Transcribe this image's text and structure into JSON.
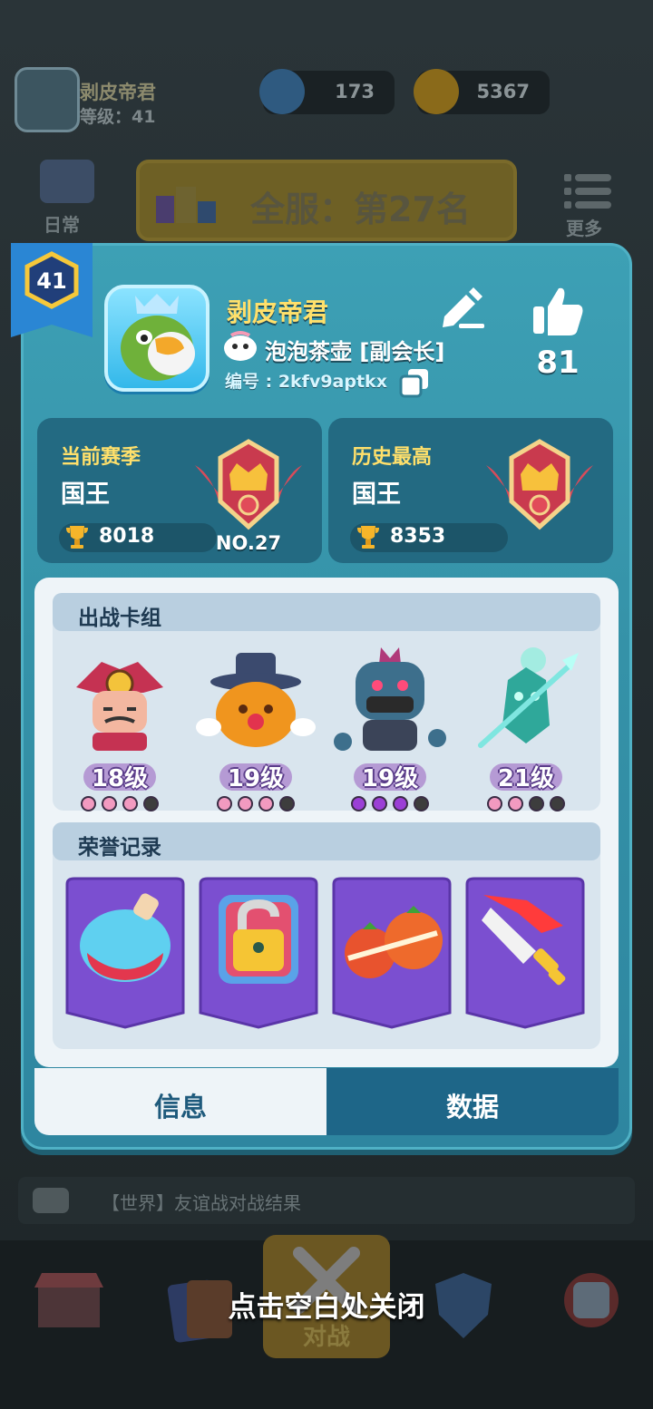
{
  "background": {
    "player_name": "剥皮帝君",
    "player_level": "等级：41",
    "gems": "173",
    "coins": "5367",
    "rank_banner": "全服：第27名",
    "daily_label": "日常",
    "more_label": "更多",
    "chat_text": "【世界】友谊战对战结果",
    "battle_label": "对战",
    "close_hint": "点击空白处关闭"
  },
  "profile": {
    "level": "41",
    "name": "剥皮帝君",
    "guild": "泡泡茶壶 [副会长]",
    "player_id": "编号 : 2kfv9aptkx",
    "likes": "81"
  },
  "season": {
    "current": {
      "label": "当前赛季",
      "tier": "国王",
      "score": "8018",
      "rank": "NO.27"
    },
    "best": {
      "label": "历史最高",
      "tier": "国王",
      "score": "8353"
    }
  },
  "deck": {
    "title": "出战卡组",
    "cards": [
      {
        "name": "samurai-hero",
        "level": "18级",
        "dots": [
          "#f29ac0",
          "#f29ac0",
          "#f29ac0",
          "#3d3d3d"
        ]
      },
      {
        "name": "pumpkin-magician-hero",
        "level": "19级",
        "dots": [
          "#f29ac0",
          "#f29ac0",
          "#f29ac0",
          "#3d3d3d"
        ]
      },
      {
        "name": "zombie-brute-hero",
        "level": "19级",
        "dots": [
          "#9b3fd6",
          "#9b3fd6",
          "#9b3fd6",
          "#3d3d3d"
        ]
      },
      {
        "name": "ghost-knight-hero",
        "level": "21级",
        "dots": [
          "#f29ac0",
          "#f29ac0",
          "#3d3d3d",
          "#3d3d3d"
        ]
      }
    ]
  },
  "honors": {
    "title": "荣誉记录",
    "badges": [
      "potion-badge-icon",
      "lock-badge-icon",
      "tomato-badge-icon",
      "sword-badge-icon"
    ]
  },
  "tabs": {
    "info": "信息",
    "data": "数据"
  },
  "colors": {
    "dialog": "#3592a8",
    "accent_yellow": "#ffe06b",
    "tab_active": "#1e6688",
    "badge_purple": "#7b4fd0"
  }
}
